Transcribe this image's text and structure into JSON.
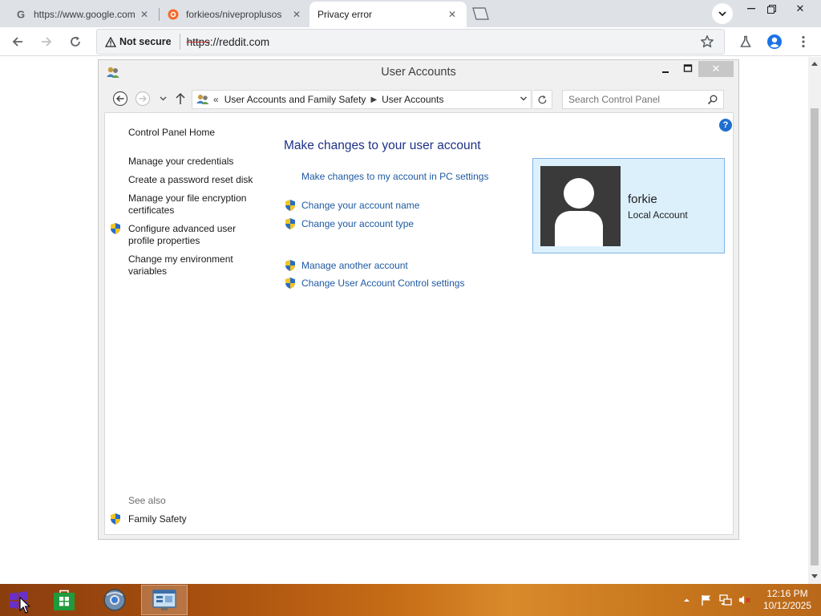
{
  "browser": {
    "tabs": [
      {
        "title": "https://www.google.com",
        "favicon": "google-g-icon",
        "active": false
      },
      {
        "title": "forkieos/niveproplusos",
        "favicon": "brave-lion-icon",
        "active": false
      },
      {
        "title": "Privacy error",
        "favicon": "",
        "active": true
      }
    ],
    "omnibox": {
      "security_label": "Not secure",
      "url_scheme": "https",
      "url_rest": "://reddit.com"
    }
  },
  "window": {
    "title": "User Accounts",
    "address": {
      "overflow": "«",
      "crumb1": "User Accounts and Family Safety",
      "crumb2": "User Accounts"
    },
    "search_placeholder": "Search Control Panel",
    "help": "?",
    "sidebar": {
      "home": "Control Panel Home",
      "links": [
        "Manage your credentials",
        "Create a password reset disk",
        "Manage your file encryption certificates",
        "Configure advanced user profile properties",
        "Change my environment variables"
      ],
      "see_also": "See also",
      "family_safety": "Family Safety"
    },
    "main": {
      "heading": "Make changes to your user account",
      "pc_settings_link": "Make changes to my account in PC settings",
      "tasks": [
        "Change your account name",
        "Change your account type",
        "Manage another account",
        "Change User Account Control settings"
      ]
    },
    "account": {
      "name": "forkie",
      "type": "Local Account"
    }
  },
  "taskbar": {
    "clock_time": "12:16 PM",
    "clock_date": "10/12/2025"
  }
}
